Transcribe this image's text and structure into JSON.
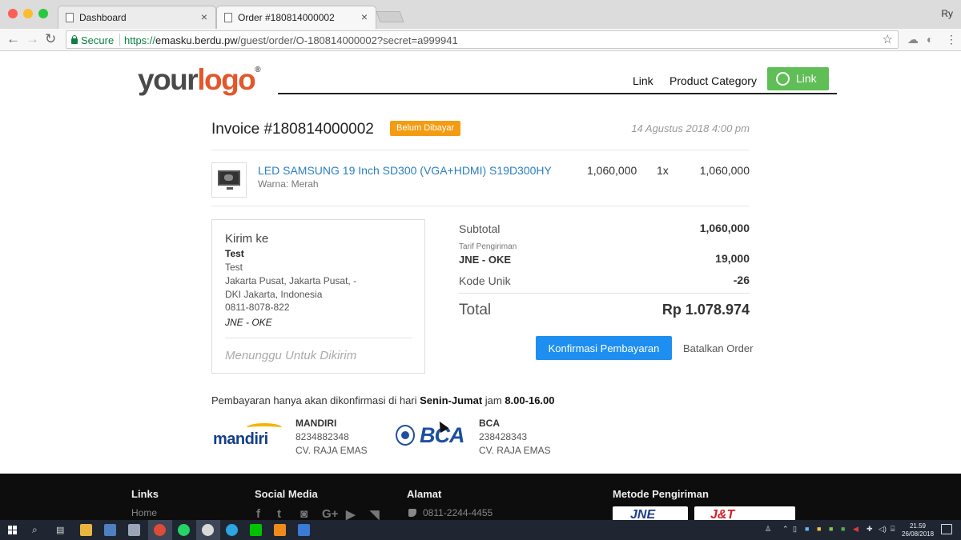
{
  "browser": {
    "tabs": [
      {
        "title": "Dashboard",
        "active": false
      },
      {
        "title": "Order #180814000002",
        "active": true
      }
    ],
    "profile": "Ry",
    "secure_label": "Secure",
    "url_scheme": "https://",
    "url_host": "emasku.berdu.pw",
    "url_path": "/guest/order/O-180814000002?secret=a999941"
  },
  "header": {
    "logo_part1": "your",
    "logo_part2": "logo",
    "logo_mark": "®",
    "nav": [
      "Link",
      "Product Category"
    ],
    "whatsapp_label": "Link",
    "whatsapp_color": "#5fbe55"
  },
  "invoice": {
    "title": "Invoice #180814000002",
    "status_badge": "Belum Dibayar",
    "status_color": "#f39c12",
    "date": "14 Agustus 2018 4:00 pm"
  },
  "item": {
    "name": "LED SAMSUNG 19 Inch SD300 (VGA+HDMI) S19D300HY",
    "variant": "Warna: Merah",
    "price": "1,060,000",
    "qty": "1x",
    "total": "1,060,000"
  },
  "shipping": {
    "title": "Kirim ke",
    "name": "Test",
    "lines": [
      "Test",
      "Jakarta Pusat, Jakarta Pusat, -",
      "DKI Jakarta, Indonesia",
      "0811-8078-822"
    ],
    "courier": "JNE - OKE",
    "status": "Menunggu Untuk Dikirim"
  },
  "summary": {
    "subtotal_label": "Subtotal",
    "subtotal": "1,060,000",
    "tarif_label": "Tarif Pengiriman",
    "shipping_label": "JNE - OKE",
    "shipping": "19,000",
    "kode_label": "Kode Unik",
    "kode": "-26",
    "total_label": "Total",
    "total": "Rp 1.078.974"
  },
  "actions": {
    "confirm": "Konfirmasi Pembayaran",
    "confirm_color": "#1e8ff0",
    "cancel": "Batalkan Order"
  },
  "payment": {
    "note_pre": "Pembayaran hanya akan dikonfirmasi di hari ",
    "note_days": "Senin-Jumat",
    "note_mid": " jam ",
    "note_hours": "8.00-16.00",
    "banks": [
      {
        "logo_text": "mandiri",
        "name": "MANDIRI",
        "account": "8234882348",
        "holder": "CV. RAJA EMAS"
      },
      {
        "logo_text": "BCA",
        "name": "BCA",
        "account": "238428343",
        "holder": "CV. RAJA EMAS"
      }
    ]
  },
  "footer": {
    "links_heading": "Links",
    "links": [
      "Home"
    ],
    "social_heading": "Social Media",
    "social_icons": [
      "facebook-icon",
      "twitter-icon",
      "instagram-icon",
      "google-plus-icon",
      "youtube-icon",
      "rss-icon"
    ],
    "address_heading": "Alamat",
    "phone": "0811-2244-4455",
    "shipping_heading": "Metode Pengiriman",
    "shipping_logos": [
      "JNE",
      "J&T"
    ]
  },
  "taskbar": {
    "time": "21.59",
    "date": "26/08/2018"
  }
}
